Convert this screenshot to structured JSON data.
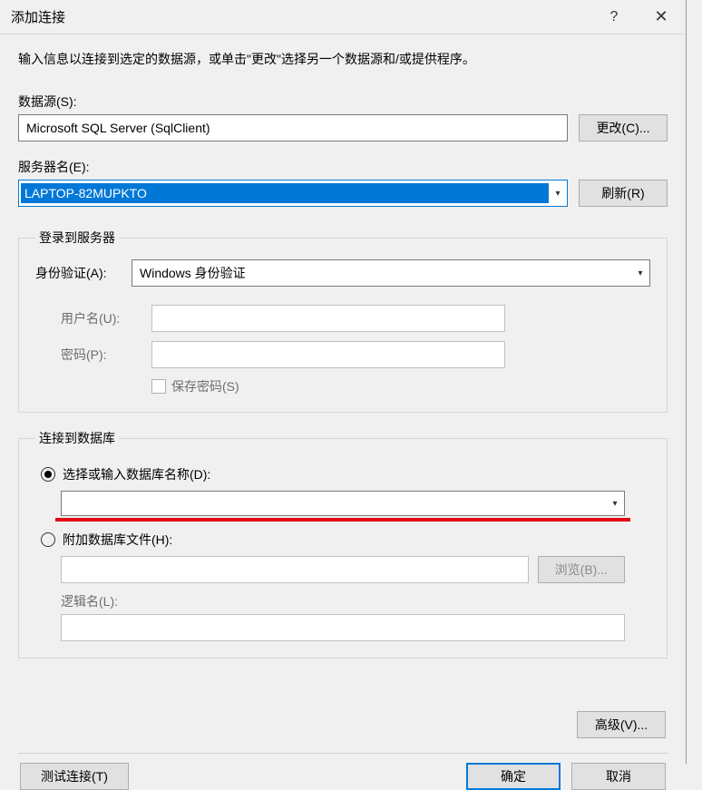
{
  "titlebar": {
    "title": "添加连接",
    "help_glyph": "?",
    "close_glyph": "✕"
  },
  "instruction": "输入信息以连接到选定的数据源，或单击\"更改\"选择另一个数据源和/或提供程序。",
  "data_source": {
    "label": "数据源(S):",
    "value": "Microsoft SQL Server (SqlClient)",
    "change_btn": "更改(C)..."
  },
  "server": {
    "label": "服务器名(E):",
    "value": "LAPTOP-82MUPKTO",
    "refresh_btn": "刷新(R)"
  },
  "login_group": {
    "legend": "登录到服务器",
    "auth_label": "身份验证(A):",
    "auth_value": "Windows 身份验证",
    "username_label": "用户名(U):",
    "username_value": "",
    "password_label": "密码(P):",
    "password_value": "",
    "save_password_label": "保存密码(S)"
  },
  "db_group": {
    "legend": "连接到数据库",
    "select_db_label": "选择或输入数据库名称(D):",
    "select_db_value": "",
    "attach_label": "附加数据库文件(H):",
    "attach_value": "",
    "browse_btn": "浏览(B)...",
    "logical_label": "逻辑名(L):",
    "logical_value": ""
  },
  "advanced_btn": "高级(V)...",
  "footer": {
    "test_btn": "测试连接(T)",
    "ok_btn": "确定",
    "cancel_btn": "取消"
  },
  "glyph": {
    "dropdown": "▾"
  }
}
